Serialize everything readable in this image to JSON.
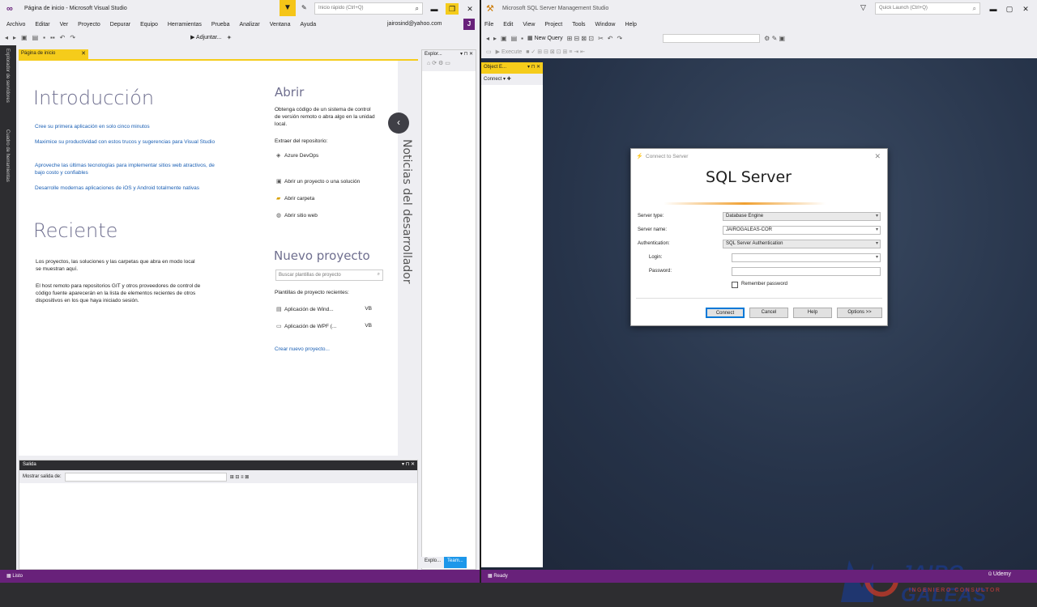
{
  "vs": {
    "title": "Página de inicio - Microsoft Visual Studio",
    "quick_launch_placeholder": "Inicio rápido (Ctrl+Q)",
    "menu": [
      "Archivo",
      "Editar",
      "Ver",
      "Proyecto",
      "Depurar",
      "Equipo",
      "Herramientas",
      "Prueba",
      "Analizar",
      "Ventana",
      "Ayuda"
    ],
    "user_email": "jairosind@yahoo.com",
    "user_initial": "J",
    "attach_label": "▶ Adjuntar...",
    "doc_tab": "Página de inicio",
    "side_tabs": [
      "Explorador de servidores",
      "Cuadro de herramientas"
    ],
    "start": {
      "intro_heading": "Introducción",
      "intro_links": [
        "Cree su primera aplicación en solo cinco minutos",
        "Maximice su productividad con estos trucos y sugerencias para Visual Studio",
        "Aproveche las últimas tecnologías para implementar sitios web atractivos, de bajo costo y confiables",
        "Desarrolle modernas aplicaciones de iOS y Android totalmente nativas"
      ],
      "recent_heading": "Reciente",
      "recent_text_1": "Los proyectos, las soluciones y las carpetas que abra en modo local se muestran aquí.",
      "recent_text_2": "El host remoto para repositorios GIT y otros proveedores de control de código fuente aparecerán en la lista de elementos recientes de otros dispositivos en los que haya iniciado sesión.",
      "open_heading": "Abrir",
      "open_desc": "Obtenga código de un sistema de control de versión remoto o abra algo en la unidad local.",
      "repo_label": "Extraer del repositorio:",
      "azure_devops": "Azure DevOps",
      "open_actions": [
        "Abrir un proyecto o una solución",
        "Abrir carpeta",
        "Abrir sitio web"
      ],
      "new_project_heading": "Nuevo proyecto",
      "template_search_placeholder": "Buscar plantillas de proyecto",
      "recent_templates_label": "Plantillas de proyecto recientes:",
      "templates": [
        {
          "name": "Aplicación de Wind...",
          "lang": "VB"
        },
        {
          "name": "Aplicación de WPF (...",
          "lang": "VB"
        }
      ],
      "create_new_project": "Crear nuevo proyecto..."
    },
    "news_title": "Noticias del desarrollador",
    "explorer_title": "Explor...",
    "explorer_tabs": [
      "Explo...",
      "Team..."
    ],
    "output_title": "Salida",
    "output_show_from": "Mostrar salida de:",
    "status": "Listo"
  },
  "ssms": {
    "title": "Microsoft SQL Server Management Studio",
    "quick_launch_placeholder": "Quick Launch (Ctrl+Q)",
    "menu": [
      "File",
      "Edit",
      "View",
      "Project",
      "Tools",
      "Window",
      "Help"
    ],
    "new_query": "New Query",
    "execute": "Execute",
    "object_explorer_title": "Object E...",
    "connect_label": "Connect ▾",
    "status": "Ready",
    "dialog": {
      "title": "Connect to Server",
      "brand": "SQL Server",
      "server_type_label": "Server type:",
      "server_type_value": "Database Engine",
      "server_name_label": "Server name:",
      "server_name_value": "JAIROGALEAS-COR",
      "auth_label": "Authentication:",
      "auth_value": "SQL Server Authentication",
      "login_label": "Login:",
      "login_value": "",
      "password_label": "Password:",
      "password_value": "",
      "remember_label": "Remember password",
      "remember_checked": false,
      "buttons": {
        "connect": "Connect",
        "cancel": "Cancel",
        "help": "Help",
        "options": "Options >>"
      }
    }
  },
  "watermark": {
    "title": "JAIRO GALEAS",
    "subtitle": "INGENIERO CONSULTOR",
    "udemy": "Udemy"
  },
  "colors": {
    "vs_purple": "#68217a",
    "vs_yellow": "#f5cc1b",
    "link_blue": "#1a5fb4",
    "ssms_bg": "#263349"
  }
}
